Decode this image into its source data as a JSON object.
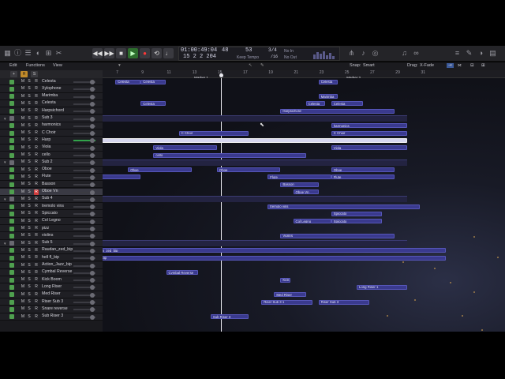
{
  "transport": {
    "icons": [
      "rewind-icon",
      "forward-icon",
      "stop-icon",
      "play-icon",
      "record-icon",
      "cycle-icon"
    ],
    "play_symbol": "▶",
    "rewind_symbol": "◀◀",
    "forward_symbol": "▶▶",
    "stop_symbol": "■",
    "record_symbol": "●"
  },
  "lcd": {
    "time": "01:00:49:04",
    "bars": "15 2 2 204",
    "tempo_top": "48",
    "tempo_bpm": "53",
    "tempo_label": "Keep Tempo",
    "sig_top": "3/4",
    "sig_bottom": "/16",
    "in_label": "No In",
    "out_label": "No Out"
  },
  "chip_label": "cd4",
  "meter_level": 0.85,
  "menus": {
    "edit": "Edit",
    "functions": "Functions",
    "view": "View",
    "snap_label": "Snap:",
    "snap_value": "Smart",
    "drag_label": "Drag:",
    "drag_value": "X-Fade"
  },
  "header_buttons": [
    "+",
    "H",
    "S"
  ],
  "ruler": {
    "ticks": [
      "7",
      "9",
      "11",
      "13",
      "15",
      "17",
      "19",
      "21",
      "23",
      "25",
      "27",
      "29",
      "31"
    ],
    "marker1": "Marker 1",
    "marker2": "Marker 2"
  },
  "tracks": [
    {
      "name": "Celesta",
      "type": "inst",
      "m": "M",
      "s": "S",
      "r": "R"
    },
    {
      "name": "Xylophone",
      "type": "inst",
      "m": "M",
      "s": "S",
      "r": "R"
    },
    {
      "name": "Marimba",
      "type": "inst",
      "m": "M",
      "s": "S",
      "r": "R"
    },
    {
      "name": "Celesta",
      "type": "inst",
      "m": "M",
      "s": "S",
      "r": "R"
    },
    {
      "name": "Harpsichord",
      "type": "inst",
      "m": "M",
      "s": "S",
      "r": "R"
    },
    {
      "name": "Sub 3",
      "type": "folder",
      "m": "M",
      "s": "S",
      "r": "R"
    },
    {
      "name": "harmonics",
      "type": "inst",
      "m": "M",
      "s": "S",
      "r": "R"
    },
    {
      "name": "C Choir",
      "type": "inst",
      "m": "M",
      "s": "S",
      "r": "R"
    },
    {
      "name": "Harp",
      "type": "inst",
      "m": "M",
      "s": "S",
      "r": "R"
    },
    {
      "name": "Viola",
      "type": "inst",
      "m": "M",
      "s": "S",
      "r": "R"
    },
    {
      "name": "cello",
      "type": "inst",
      "m": "M",
      "s": "S",
      "r": "R"
    },
    {
      "name": "Sub 2",
      "type": "folder",
      "m": "M",
      "s": "S",
      "r": "R"
    },
    {
      "name": "Oboe",
      "type": "inst",
      "m": "M",
      "s": "S",
      "r": "R"
    },
    {
      "name": "Flute",
      "type": "inst",
      "m": "M",
      "s": "S",
      "r": "R"
    },
    {
      "name": "Basson",
      "type": "inst",
      "m": "M",
      "s": "S",
      "r": "R"
    },
    {
      "name": "Oboe Vn",
      "type": "inst",
      "m": "M",
      "s": "S",
      "r": "R"
    },
    {
      "name": "Sub 4",
      "type": "folder",
      "m": "M",
      "s": "S",
      "r": "R"
    },
    {
      "name": "tremolo vins",
      "type": "inst",
      "m": "M",
      "s": "S",
      "r": "R"
    },
    {
      "name": "Spiccato",
      "type": "inst",
      "m": "M",
      "s": "S",
      "r": "R"
    },
    {
      "name": "Col Legno",
      "type": "inst",
      "m": "M",
      "s": "S",
      "r": "R"
    },
    {
      "name": "pizz",
      "type": "inst",
      "m": "M",
      "s": "S",
      "r": "R"
    },
    {
      "name": "violins",
      "type": "inst",
      "m": "M",
      "s": "S",
      "r": "R"
    },
    {
      "name": "Sub 5",
      "type": "folder",
      "m": "M",
      "s": "S",
      "r": "R"
    },
    {
      "name": "Raudan_zed_bip",
      "type": "audio",
      "m": "M",
      "s": "S",
      "r": "R"
    },
    {
      "name": "hell fl_bip",
      "type": "audio",
      "m": "M",
      "s": "S",
      "r": "R"
    },
    {
      "name": "Action_Jazz_bip",
      "type": "audio",
      "m": "M",
      "s": "S",
      "r": "R"
    },
    {
      "name": "Cymbal Reverse",
      "type": "audio",
      "m": "M",
      "s": "S",
      "r": "R"
    },
    {
      "name": "Kick Boom",
      "type": "audio",
      "m": "M",
      "s": "S",
      "r": "R"
    },
    {
      "name": "Long Riser",
      "type": "audio",
      "m": "M",
      "s": "S",
      "r": "R"
    },
    {
      "name": "Med Riser",
      "type": "audio",
      "m": "M",
      "s": "S",
      "r": "R"
    },
    {
      "name": "Riser Sub 3",
      "type": "audio",
      "m": "M",
      "s": "S",
      "r": "R"
    },
    {
      "name": "Snare reverse",
      "type": "audio",
      "m": "M",
      "s": "S",
      "r": "R"
    },
    {
      "name": "Sub Riser 3",
      "type": "audio",
      "m": "M",
      "s": "S",
      "r": "R"
    }
  ],
  "regions": [
    {
      "label": "Celesta",
      "row": 0,
      "start": 7,
      "len": 2
    },
    {
      "label": "Celesta",
      "row": 0,
      "start": 9,
      "len": 2
    },
    {
      "label": "Celesta",
      "row": 0,
      "start": 23,
      "len": 1.5
    },
    {
      "label": "Celesta",
      "row": 3,
      "start": 9,
      "len": 2
    },
    {
      "label": "Celesta",
      "row": 3,
      "start": 22,
      "len": 1.5
    },
    {
      "label": "Celesta",
      "row": 3,
      "start": 24,
      "len": 2.5
    },
    {
      "label": "Marimba",
      "row": 2,
      "start": 23,
      "len": 1.5
    },
    {
      "label": "Harpsichord",
      "row": 4,
      "start": 20,
      "len": 9
    },
    {
      "label": "harmonics",
      "row": 6,
      "start": 24,
      "len": 6
    },
    {
      "label": "C Choir",
      "row": 7,
      "start": 12,
      "len": 5.5
    },
    {
      "label": "C Choir",
      "row": 7,
      "start": 24,
      "len": 6
    },
    {
      "label": "Harp",
      "row": 8,
      "start": 5,
      "len": 25
    },
    {
      "label": "Viola",
      "row": 9,
      "start": 10,
      "len": 5
    },
    {
      "label": "Viola",
      "row": 9,
      "start": 24,
      "len": 6
    },
    {
      "label": "cello",
      "row": 10,
      "start": 10,
      "len": 12
    },
    {
      "label": "Oboe",
      "row": 12,
      "start": 8,
      "len": 5
    },
    {
      "label": "Oboe",
      "row": 12,
      "start": 15,
      "len": 5
    },
    {
      "label": "Oboe",
      "row": 12,
      "start": 24,
      "len": 5
    },
    {
      "label": "Flute",
      "row": 13,
      "start": 5,
      "len": 4
    },
    {
      "label": "Flute",
      "row": 13,
      "start": 19,
      "len": 5
    },
    {
      "label": "Flute",
      "row": 13,
      "start": 24,
      "len": 5
    },
    {
      "label": "Basson",
      "row": 14,
      "start": 20,
      "len": 3
    },
    {
      "label": "Oboe Vn",
      "row": 15,
      "start": 21,
      "len": 2
    },
    {
      "label": "tremolo vins",
      "row": 17,
      "start": 19,
      "len": 12
    },
    {
      "label": "Spiccato",
      "row": 18,
      "start": 24,
      "len": 4
    },
    {
      "label": "Col Legno",
      "row": 19,
      "start": 21,
      "len": 3
    },
    {
      "label": "Spiccato",
      "row": 19,
      "start": 24,
      "len": 4
    },
    {
      "label": "Violins",
      "row": 21,
      "start": 20,
      "len": 9
    },
    {
      "label": "Raudan_zed_bip",
      "row": 23,
      "start": 5,
      "len": 28
    },
    {
      "label": "hell fl_bip",
      "row": 24,
      "start": 5,
      "len": 28
    },
    {
      "label": "Cymbal Reverse",
      "row": 26,
      "start": 11,
      "len": 2.5
    },
    {
      "label": "Kick",
      "row": 27,
      "start": 20,
      "len": 0.8
    },
    {
      "label": "Long Riser 1",
      "row": 28,
      "start": 26,
      "len": 4
    },
    {
      "label": "Med Riser",
      "row": 29,
      "start": 19.5,
      "len": 2.5
    },
    {
      "label": "Riser Sub 3 1",
      "row": 30,
      "start": 18.5,
      "len": 4
    },
    {
      "label": "Riser Sub 3",
      "row": 30,
      "start": 23,
      "len": 4
    },
    {
      "label": "Sub Riser 3",
      "row": 32,
      "start": 14.5,
      "len": 3
    }
  ],
  "folder_lanes": [
    {
      "label": "Sub 3",
      "row": 5,
      "start": 5,
      "len": 25
    },
    {
      "label": "Sub 2",
      "row": 11,
      "start": 5,
      "len": 25
    },
    {
      "label": "Sub 4",
      "row": 16,
      "start": 5,
      "len": 25
    },
    {
      "label": "Sub 5",
      "row": 22,
      "start": 5,
      "len": 25
    }
  ],
  "playhead_bar": 15.3,
  "selected_track": 15
}
